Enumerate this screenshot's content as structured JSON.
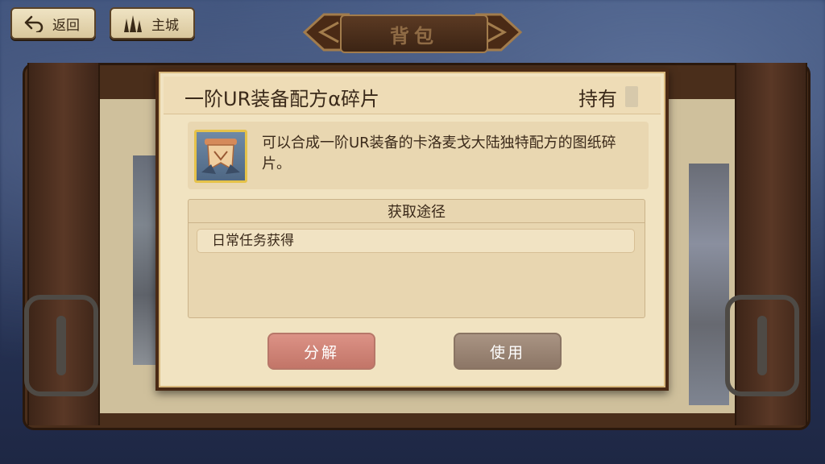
{
  "nav": {
    "back_label": "返回",
    "main_city_label": "主城"
  },
  "page_title": "背包",
  "item": {
    "name": "一阶UR装备配方α碎片",
    "own_label": "持有",
    "icon": "scroll-recipe-icon",
    "description": "可以合成一阶UR装备的卡洛麦戈大陆独特配方的图纸碎片。"
  },
  "acquire": {
    "header": "获取途径",
    "sources": [
      "日常任务获得"
    ]
  },
  "buttons": {
    "decompose_label": "分解",
    "use_label": "使用"
  },
  "colors": {
    "decompose": "#d4897c",
    "use": "#9b8574",
    "frame": "#4a2a15",
    "parchment": "#f1e3c1"
  }
}
